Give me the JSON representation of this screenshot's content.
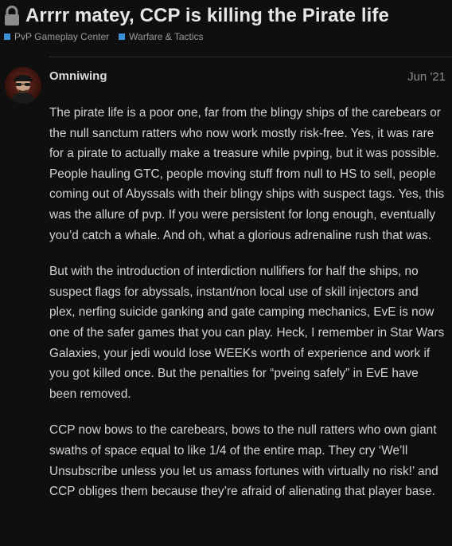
{
  "topic": {
    "title": "Arrrr matey, CCP is killing the Pirate life",
    "lock_icon": "lock-icon",
    "categories": [
      {
        "label": "PvP Gameplay Center",
        "color": "#3b8fd6"
      },
      {
        "label": "Warfare & Tactics",
        "color": "#3b8fd6"
      }
    ]
  },
  "post": {
    "avatar_icon": "pirate-avatar",
    "username": "Omniwing",
    "date": "Jun '21",
    "paragraphs": [
      "The pirate life is a poor one, far from the blingy ships of the carebears or the null sanctum ratters who now work mostly risk-free. Yes, it was rare for a pirate to actually make a treasure while pvping, but it was possible. People hauling GTC, people moving stuff from null to HS to sell, people coming out of Abyssals with their blingy ships with suspect tags. Yes, this was the allure of pvp. If you were persistent for long enough, eventually you’d catch a whale. And oh, what a glorious adrenaline rush that was.",
      "But with the introduction of interdiction nullifiers for half the ships, no suspect flags for abyssals, instant/non local use of skill injectors and plex, nerfing suicide ganking and gate camping mechanics, EvE is now one of the safer games that you can play. Heck, I remember in Star Wars Galaxies, your jedi would lose WEEKs worth of experience and work if you got killed once. But the penalties for “pveing safely” in EvE have been removed.",
      "CCP now bows to the carebears, bows to the null ratters who own giant swaths of space equal to like 1/4 of the entire map. They cry ‘We’ll Unsubscribe unless you let us amass fortunes with virtually no risk!’ and CCP obliges them because they’re afraid of alienating that player base."
    ]
  }
}
